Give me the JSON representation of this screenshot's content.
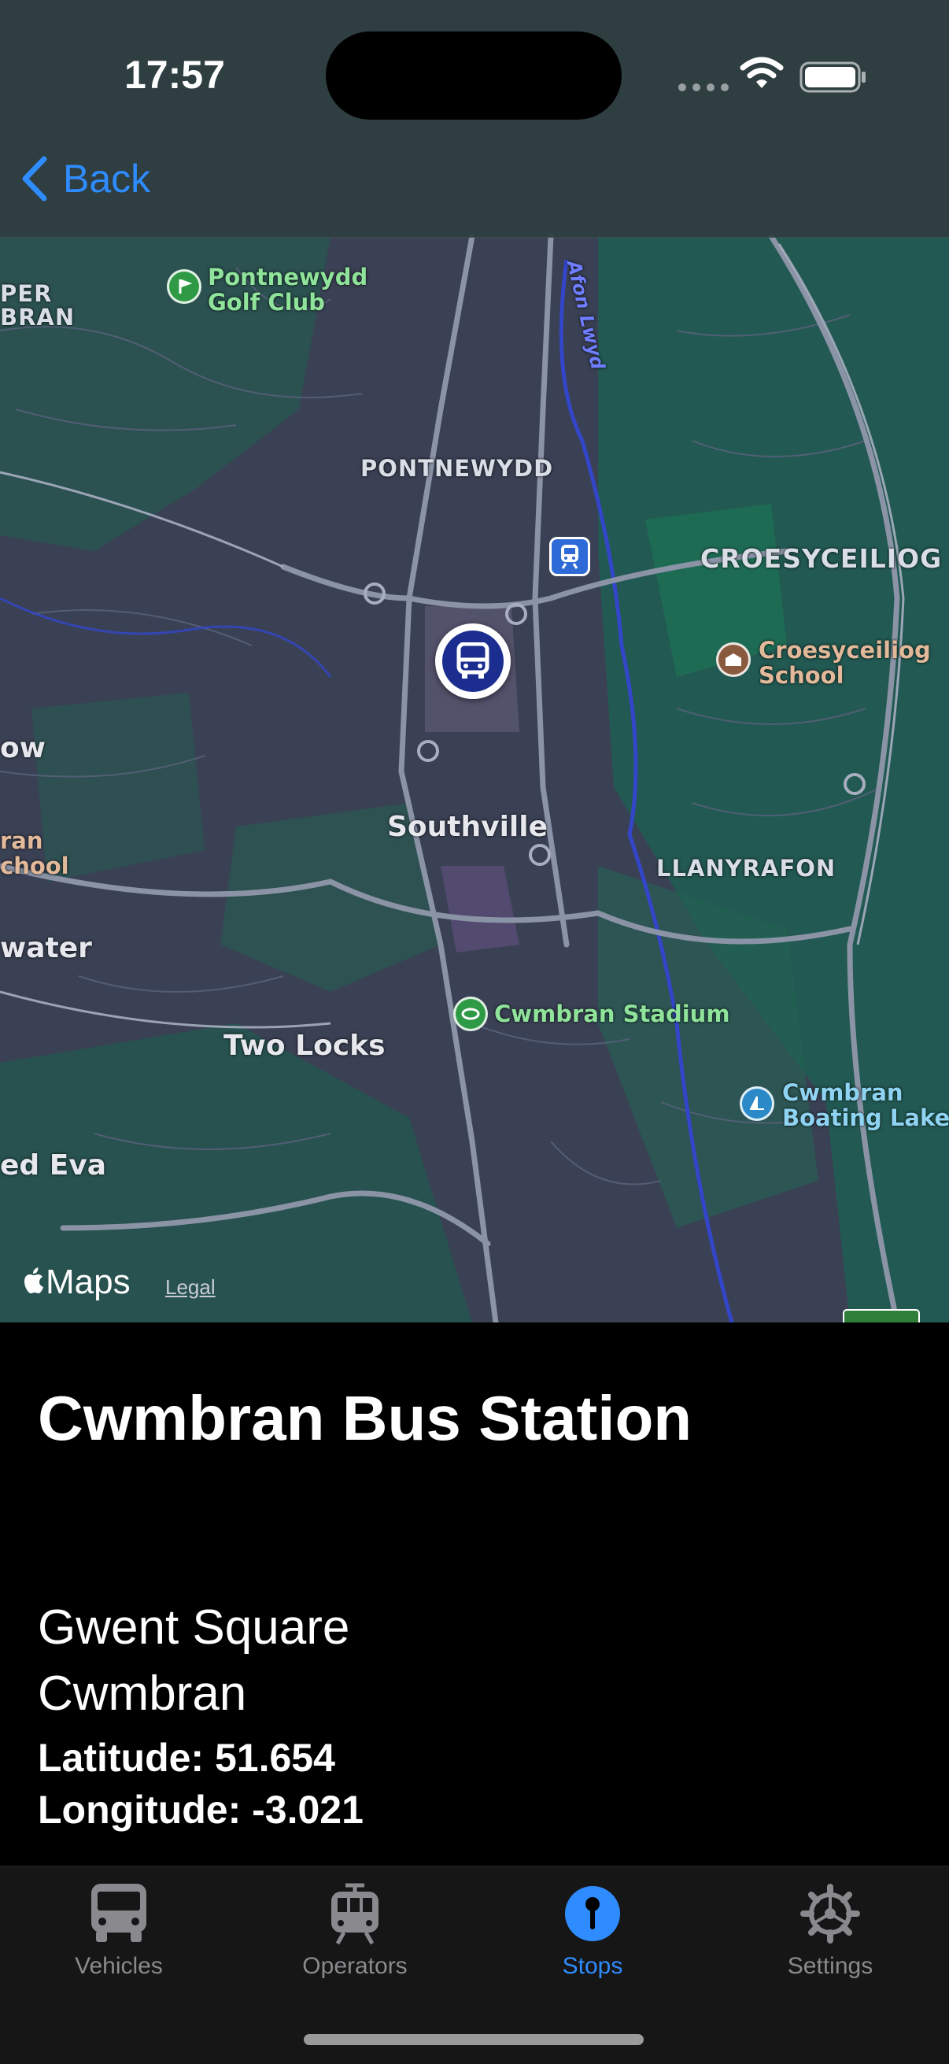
{
  "status_bar": {
    "time": "17:57"
  },
  "nav": {
    "back_label": "Back"
  },
  "map": {
    "labels": {
      "per_bran": "PER\nBRAN",
      "pontnewydd_golf": "Pontnewydd\nGolf Club",
      "river": "Afon Lwyd",
      "pontnewydd": "PONTNEWYDD",
      "croesyceiliog": "CROESYCEILIOG",
      "croesyceiliog_school": "Croesyceiliog\nSchool",
      "ow": "ow",
      "ran_school": "ran\nchool",
      "southville": "Southville",
      "llanyrafon": "LLANYRAFON",
      "water": "water",
      "cwmbran_stadium": "Cwmbran Stadium",
      "two_locks": "Two Locks",
      "boating_lake": "Cwmbran\nBoating Lake",
      "ed_eva": "ed Eva"
    },
    "attribution": "Maps",
    "legal": "Legal",
    "colors": {
      "land": "#3a4154",
      "park": "#1f6a55",
      "road": "#8b93a6",
      "water": "#3b4cc0",
      "bus_marker": "#1b2e8f"
    }
  },
  "stop": {
    "name": "Cwmbran Bus Station",
    "address_line1": "Gwent Square",
    "address_line2": "Cwmbran",
    "latitude_text": "Latitude: 51.654",
    "longitude_text": "Longitude: -3.021"
  },
  "tabs": [
    {
      "label": "Vehicles",
      "icon": "bus-icon",
      "active": false
    },
    {
      "label": "Operators",
      "icon": "tram-icon",
      "active": false
    },
    {
      "label": "Stops",
      "icon": "stop-pin-icon",
      "active": true
    },
    {
      "label": "Settings",
      "icon": "gear-icon",
      "active": false
    }
  ],
  "accent_color": "#2f8cff"
}
